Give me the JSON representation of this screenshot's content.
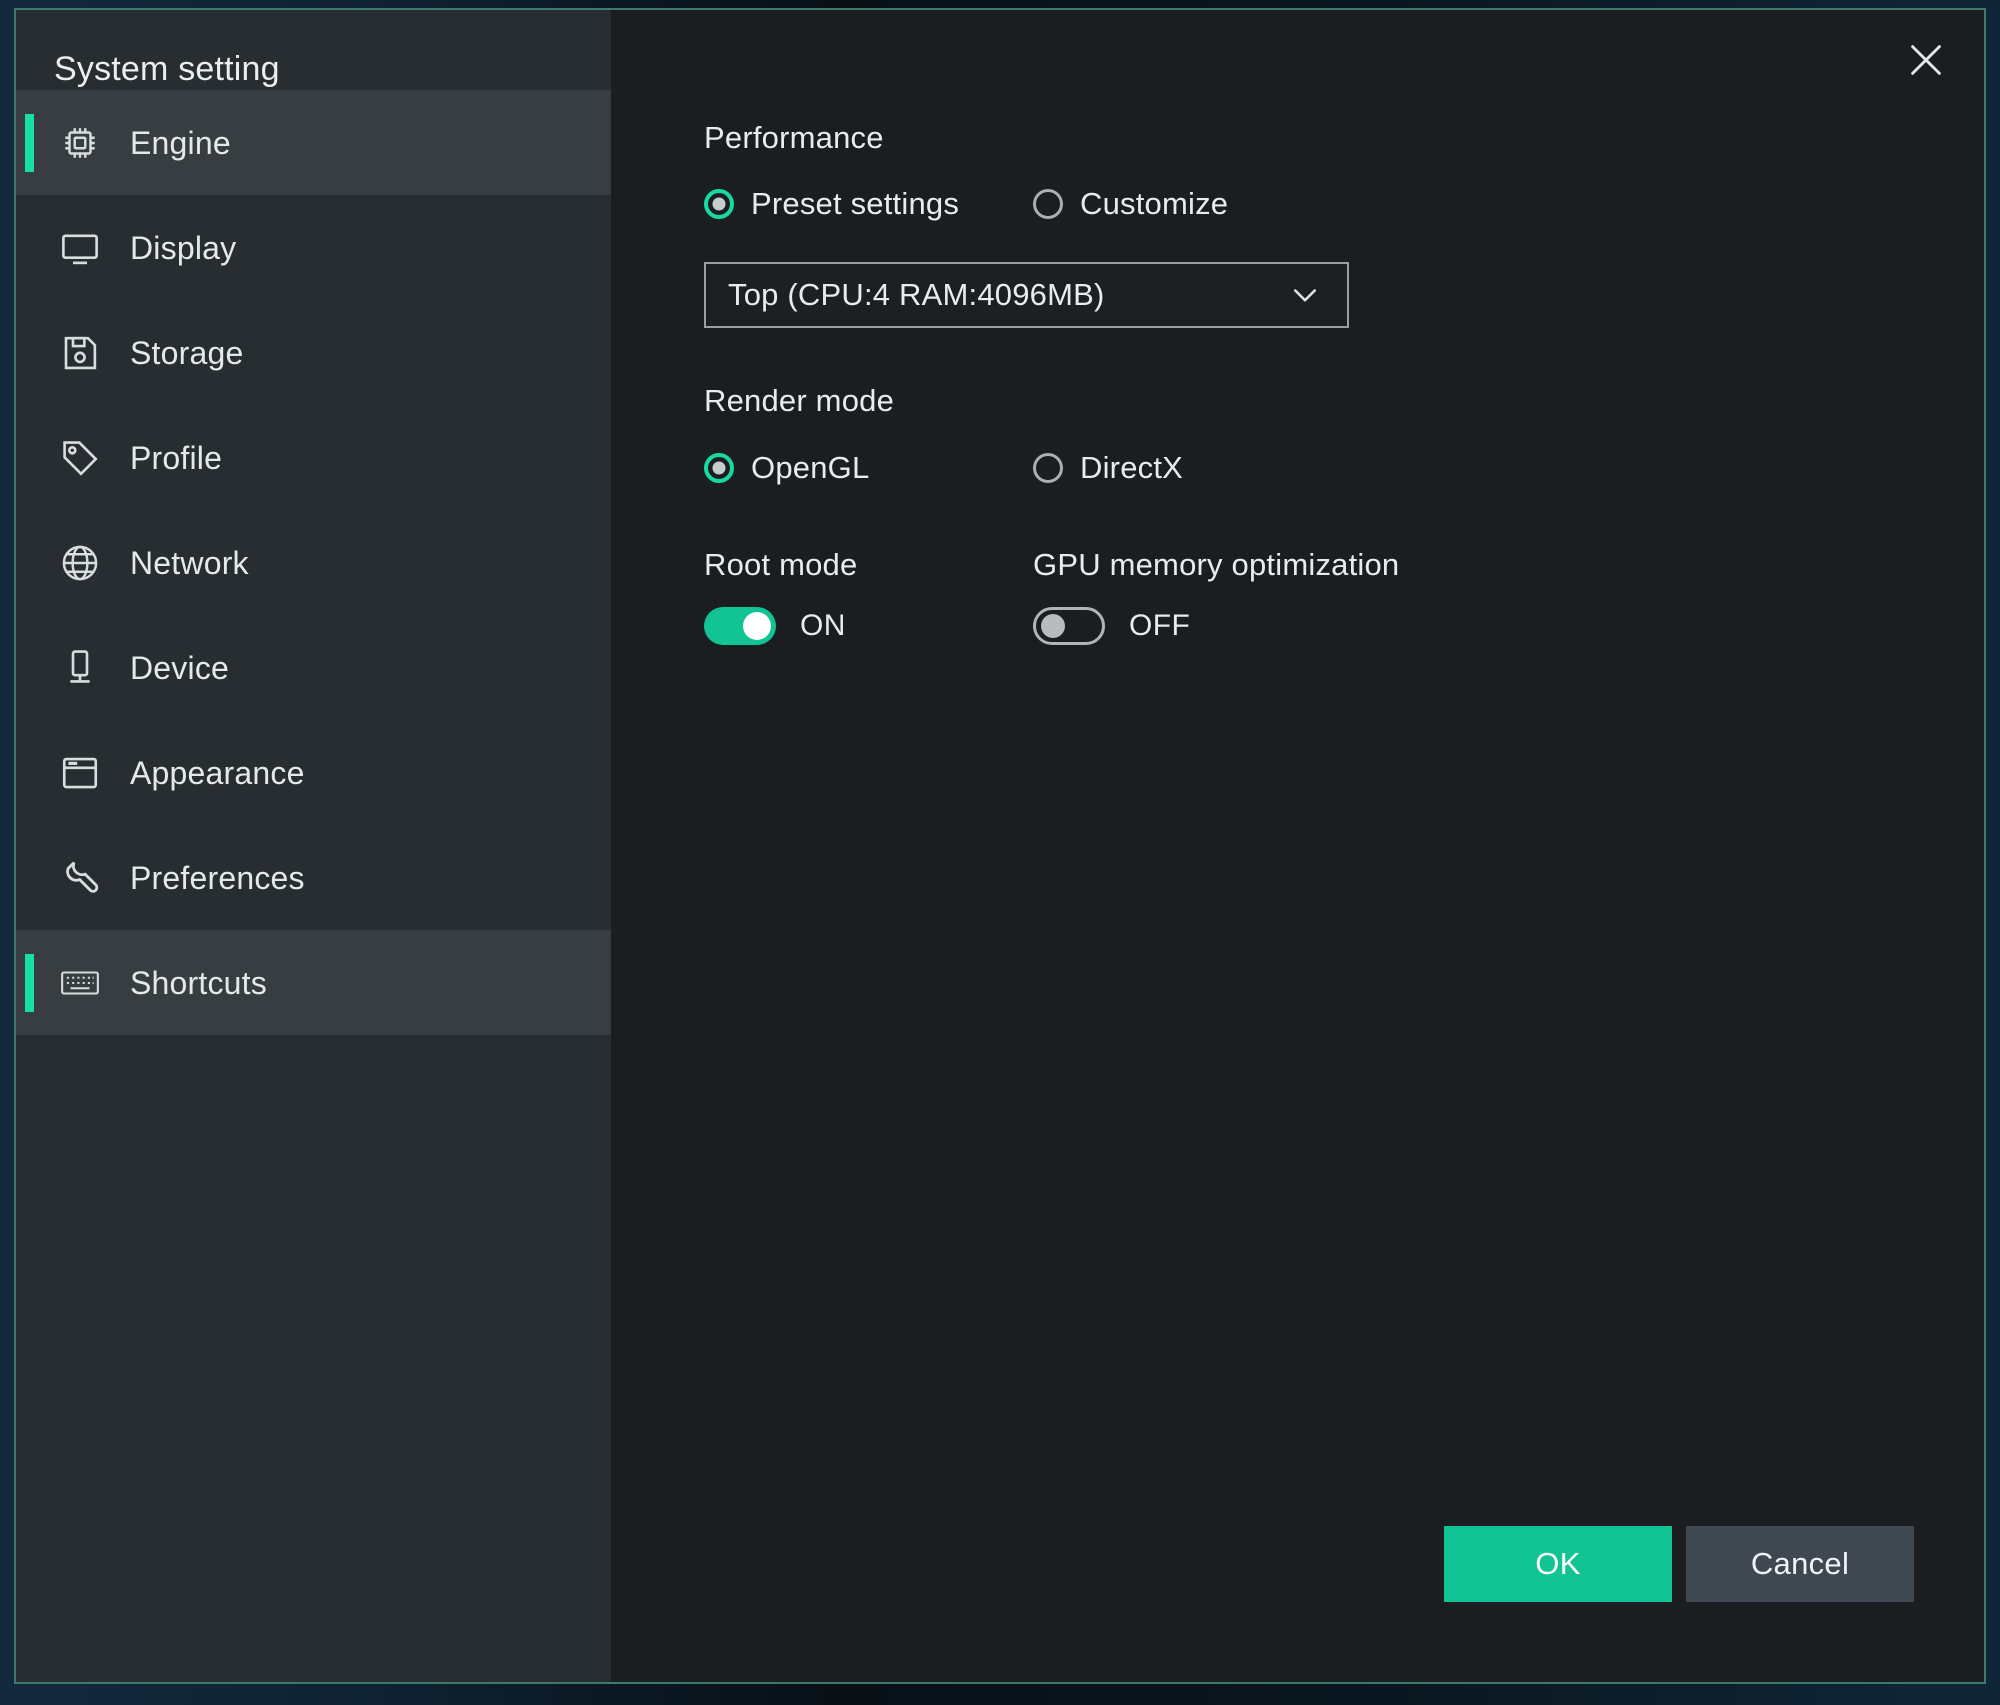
{
  "window": {
    "title": "System setting",
    "close_icon": "close-icon",
    "accent_color": "#17e0a7",
    "border_color": "#3d7a6d",
    "sidebar_bg": "#282d31",
    "content_bg": "#1a1e21"
  },
  "sidebar": {
    "items": [
      {
        "label": "Engine",
        "icon": "cpu-chip-icon",
        "active": true
      },
      {
        "label": "Display",
        "icon": "monitor-icon",
        "active": false
      },
      {
        "label": "Storage",
        "icon": "floppy-disk-icon",
        "active": false
      },
      {
        "label": "Profile",
        "icon": "tag-icon",
        "active": false
      },
      {
        "label": "Network",
        "icon": "globe-icon",
        "active": false
      },
      {
        "label": "Device",
        "icon": "phone-stand-icon",
        "active": false
      },
      {
        "label": "Appearance",
        "icon": "window-icon",
        "active": false
      },
      {
        "label": "Preferences",
        "icon": "wrench-icon",
        "active": false
      },
      {
        "label": "Shortcuts",
        "icon": "keyboard-icon",
        "active": false
      }
    ]
  },
  "performance": {
    "title": "Performance",
    "options": [
      {
        "label": "Preset settings",
        "selected": true
      },
      {
        "label": "Customize",
        "selected": false
      }
    ],
    "preset_value": "Top (CPU:4 RAM:4096MB)",
    "caret_icon": "chevron-down-icon"
  },
  "render_mode": {
    "title": "Render mode",
    "options": [
      {
        "label": "OpenGL",
        "selected": true
      },
      {
        "label": "DirectX",
        "selected": false
      }
    ]
  },
  "root_mode": {
    "title": "Root mode",
    "state_label": "ON",
    "on": true
  },
  "gpu_memory_optimization": {
    "title": "GPU memory optimization",
    "state_label": "OFF",
    "on": false
  },
  "footer": {
    "ok_label": "OK",
    "cancel_label": "Cancel"
  }
}
